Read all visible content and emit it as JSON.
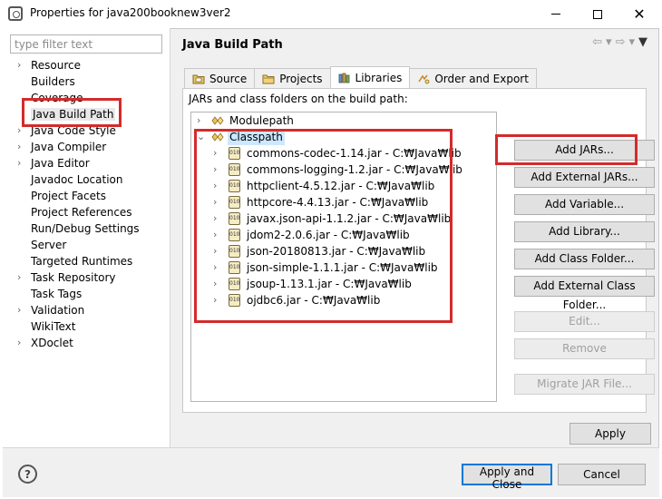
{
  "window": {
    "title": "Properties for java200booknew3ver2",
    "minimize": "—",
    "maximize": "□",
    "close": "✕"
  },
  "sidebar": {
    "filter_placeholder": "type filter text",
    "items": [
      {
        "label": "Resource",
        "arrow": "›"
      },
      {
        "label": "Builders",
        "arrow": ""
      },
      {
        "label": "Coverage",
        "arrow": ""
      },
      {
        "label": "Java Build Path",
        "arrow": ""
      },
      {
        "label": "Java Code Style",
        "arrow": "›"
      },
      {
        "label": "Java Compiler",
        "arrow": "›"
      },
      {
        "label": "Java Editor",
        "arrow": "›"
      },
      {
        "label": "Javadoc Location",
        "arrow": ""
      },
      {
        "label": "Project Facets",
        "arrow": ""
      },
      {
        "label": "Project References",
        "arrow": ""
      },
      {
        "label": "Run/Debug Settings",
        "arrow": ""
      },
      {
        "label": "Server",
        "arrow": ""
      },
      {
        "label": "Targeted Runtimes",
        "arrow": ""
      },
      {
        "label": "Task Repository",
        "arrow": "›"
      },
      {
        "label": "Task Tags",
        "arrow": ""
      },
      {
        "label": "Validation",
        "arrow": "›"
      },
      {
        "label": "WikiText",
        "arrow": ""
      },
      {
        "label": "XDoclet",
        "arrow": "›"
      }
    ]
  },
  "main": {
    "title": "Java Build Path",
    "nav": {
      "back": "⇦",
      "drop1": "▾",
      "forward": "⇨",
      "drop2": "▾",
      "menu": "▼"
    },
    "tabs": [
      {
        "label": "Source"
      },
      {
        "label": "Projects"
      },
      {
        "label": "Libraries"
      },
      {
        "label": "Order and Export"
      }
    ],
    "description": "JARs and class folders on the build path:",
    "tree": {
      "modulepath": "Modulepath",
      "classpath": "Classpath",
      "jars": [
        "commons-codec-1.14.jar - C:₩Java₩lib",
        "commons-logging-1.2.jar - C:₩Java₩lib",
        "httpclient-4.5.12.jar - C:₩Java₩lib",
        "httpcore-4.4.13.jar - C:₩Java₩lib",
        "javax.json-api-1.1.2.jar - C:₩Java₩lib",
        "jdom2-2.0.6.jar - C:₩Java₩lib",
        "json-20180813.jar - C:₩Java₩lib",
        "json-simple-1.1.1.jar - C:₩Java₩lib",
        "jsoup-1.13.1.jar - C:₩Java₩lib",
        "ojdbc6.jar - C:₩Java₩lib"
      ]
    },
    "buttons": {
      "add_jars": "Add JARs...",
      "add_external_jars": "Add External JARs...",
      "add_variable": "Add Variable...",
      "add_library": "Add Library...",
      "add_class_folder": "Add Class Folder...",
      "add_external_class_folder": "Add External Class Folder...",
      "edit": "Edit...",
      "remove": "Remove",
      "migrate": "Migrate JAR File..."
    },
    "apply": "Apply"
  },
  "footer": {
    "help": "?",
    "apply_close": "Apply and Close",
    "cancel": "Cancel"
  },
  "colors": {
    "highlight_red": "#d32b2b",
    "default_button_border": "#0078d7",
    "disabled_text": "#a0a0a0"
  }
}
